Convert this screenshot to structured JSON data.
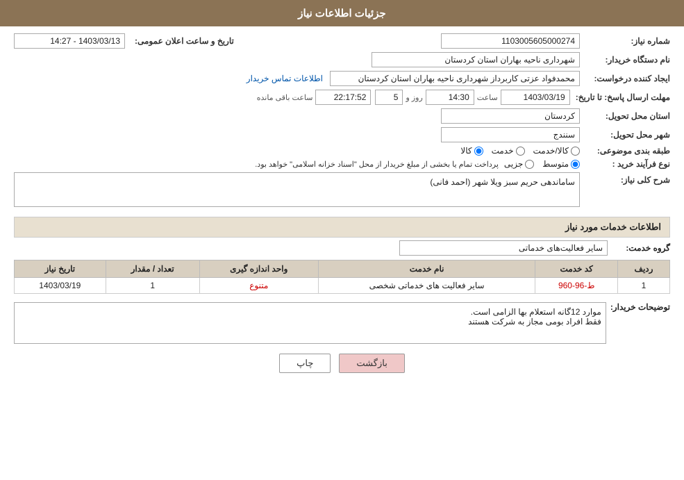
{
  "header": {
    "title": "جزئیات اطلاعات نیاز"
  },
  "fields": {
    "need_number_label": "شماره نیاز:",
    "need_number_value": "1103005605000274",
    "announce_date_label": "تاریخ و ساعت اعلان عمومی:",
    "announce_date_value": "1403/03/13 - 14:27",
    "buyer_org_label": "نام دستگاه خریدار:",
    "buyer_org_value": "شهرداری ناحیه بهاران استان کردستان",
    "creator_label": "ایجاد کننده درخواست:",
    "creator_value": "محمدفواد عزتی کاربرداز شهرداری ناحیه بهاران استان کردستان",
    "contact_link": "اطلاعات تماس خریدار",
    "response_deadline_label": "مهلت ارسال پاسخ: تا تاریخ:",
    "response_date": "1403/03/19",
    "response_time_label": "ساعت",
    "response_time": "14:30",
    "response_day_label": "روز و",
    "response_days": "5",
    "response_remaining_label": "ساعت باقی مانده",
    "response_remaining": "22:17:52",
    "province_label": "استان محل تحویل:",
    "province_value": "کردستان",
    "city_label": "شهر محل تحویل:",
    "city_value": "سنندج",
    "category_label": "طبقه بندی موضوعی:",
    "category_options": [
      "کالا",
      "خدمت",
      "کالا/خدمت"
    ],
    "category_selected": "کالا",
    "purchase_type_label": "نوع فرآیند خرید :",
    "purchase_type_options": [
      "جزیی",
      "متوسط"
    ],
    "purchase_type_selected": "متوسط",
    "purchase_type_note": "پرداخت تمام یا بخشی از مبلغ خریدار از محل \"اسناد خزانه اسلامی\" خواهد بود.",
    "need_description_label": "شرح کلی نیاز:",
    "need_description_value": "ساماندهی حریم سبز ویلا شهر (احمد فانی)",
    "services_info_label": "اطلاعات خدمات مورد نیاز",
    "service_group_label": "گروه خدمت:",
    "service_group_value": "سایر فعالیت‌های خدماتی",
    "table": {
      "headers": [
        "ردیف",
        "کد خدمت",
        "نام خدمت",
        "واحد اندازه گیری",
        "تعداد / مقدار",
        "تاریخ نیاز"
      ],
      "rows": [
        {
          "row": "1",
          "code": "ط-96-960",
          "name": "سایر فعالیت های خدماتی شخصی",
          "unit": "متنوع",
          "count": "1",
          "date": "1403/03/19"
        }
      ]
    },
    "buyer_notes_label": "توضیحات خریدار:",
    "buyer_notes_line1": "موارد 12گانه استعلام بها الزامی است.",
    "buyer_notes_line2": "فقط افراد بومی مجاز به شرکت هستند"
  },
  "buttons": {
    "print": "چاپ",
    "back": "بازگشت"
  }
}
